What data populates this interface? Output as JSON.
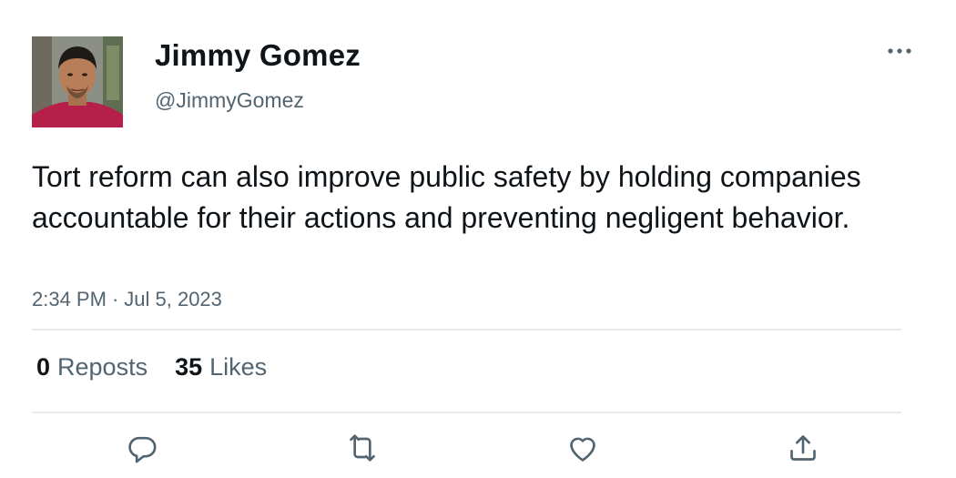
{
  "user": {
    "name": "Jimmy Gomez",
    "handle": "@JimmyGomez"
  },
  "tweet": {
    "text": "Tort reform can also improve public safety by holding companies accountable for their actions and preventing negligent behavior.",
    "time": "2:34 PM",
    "separator": "·",
    "date": "Jul 5, 2023"
  },
  "stats": {
    "reposts_count": "0",
    "reposts_label": "Reposts",
    "likes_count": "35",
    "likes_label": "Likes"
  },
  "icons": {
    "more": "more-horizontal-icon",
    "reply": "reply-icon",
    "repost": "repost-icon",
    "like": "heart-icon",
    "share": "share-icon"
  },
  "colors": {
    "text_primary": "#0f1419",
    "text_secondary": "#536471",
    "divider": "#e7e9ea"
  }
}
